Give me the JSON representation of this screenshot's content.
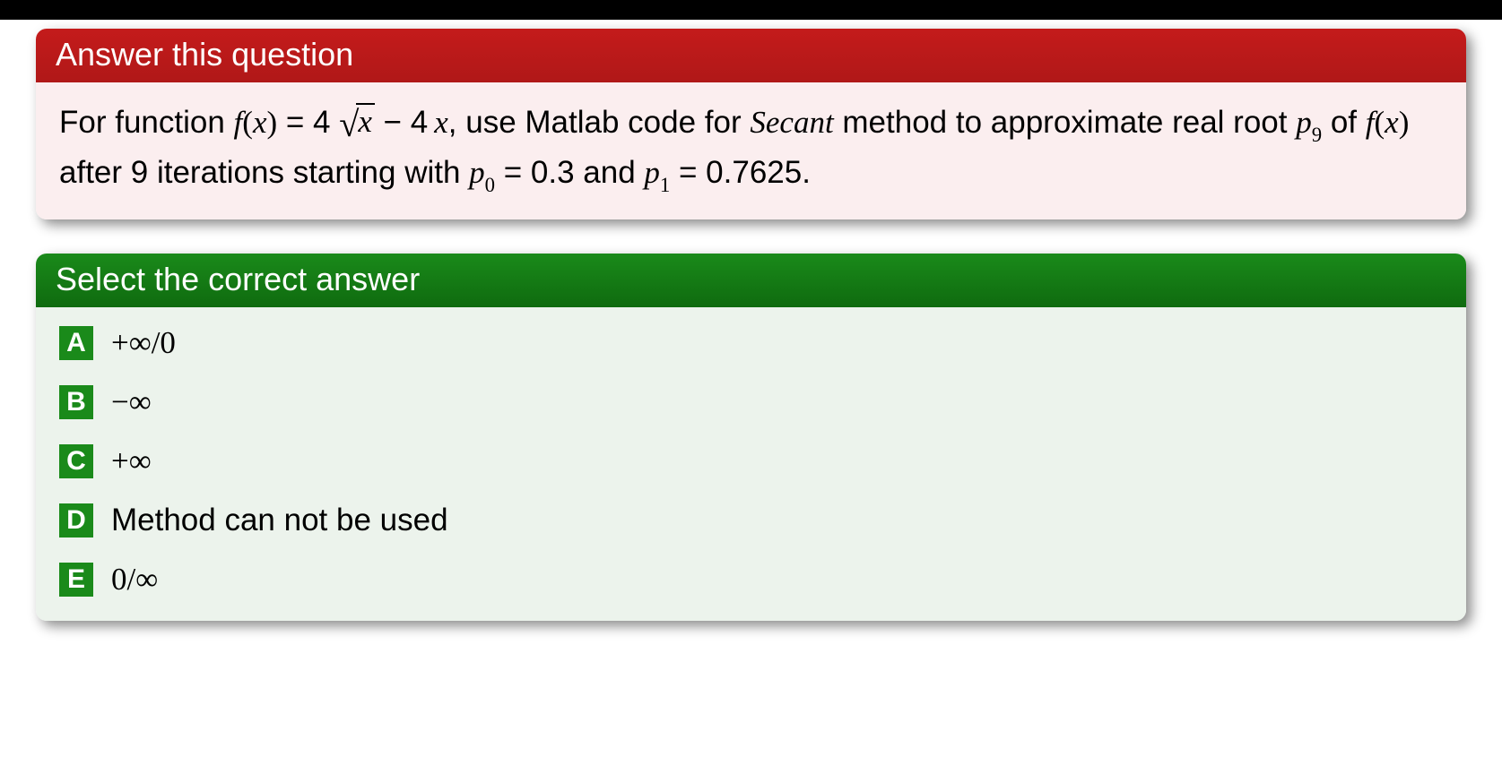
{
  "question": {
    "header": "Answer this question",
    "text_pre": "For function ",
    "fx": "f",
    "lparen": "(",
    "x": "x",
    "rparen": ")",
    "eq1": " = 4",
    "sqrt_arg": "x",
    "minus": " − 4",
    "x2": "x",
    "text_mid": ", use Matlab code for ",
    "secant": "Secant",
    "text_method": " method to approximate real root ",
    "p9_p": "p",
    "p9_sub": "9",
    "text_of": " of ",
    "fx2": "f",
    "lp2": "(",
    "x3": "x",
    "rp2": ")",
    "text_after": " after 9 iterations starting with ",
    "p0_p": "p",
    "p0_sub": "0",
    "eq2": " = 0.3 and ",
    "p1_p": "p",
    "p1_sub": "1",
    "eq3": " = 0.7625."
  },
  "answers": {
    "header": "Select the correct answer",
    "options": {
      "a": {
        "key": "A",
        "text": "+∞/0"
      },
      "b": {
        "key": "B",
        "text": "−∞"
      },
      "c": {
        "key": "C",
        "text": "+∞"
      },
      "d": {
        "key": "D",
        "text": "Method can not be used"
      },
      "e": {
        "key": "E",
        "text": "0/∞"
      }
    }
  }
}
